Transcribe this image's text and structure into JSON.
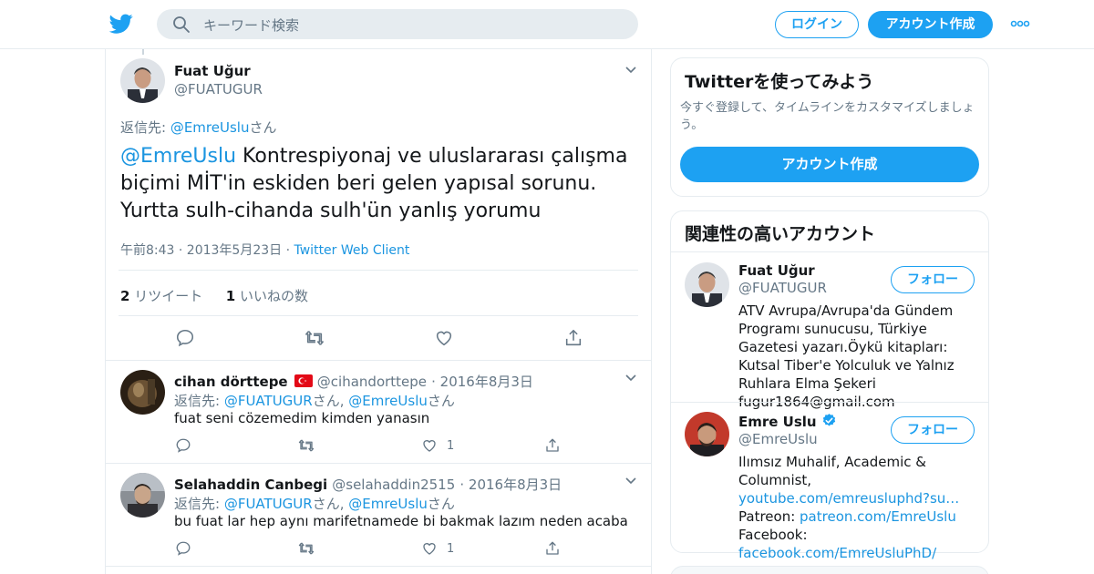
{
  "header": {
    "search_placeholder": "キーワード検索",
    "login_label": "ログイン",
    "signup_label": "アカウント作成"
  },
  "main_tweet": {
    "name": "Fuat Uğur",
    "handle": "@FUATUGUR",
    "reply_prefix": "返信先: ",
    "reply_mention": "@EmreUslu",
    "reply_suffix": "さん",
    "text_mention": "@EmreUslu",
    "text": " Kontrespiyonaj ve uluslararası çalışma biçimi MİT'in eskiden beri gelen yapısal sorunu. Yurtta sulh-cihanda sulh'ün yanlış yorumu",
    "timestamp": "午前8:43 · 2013年5月23日 · ",
    "source": "Twitter Web Client",
    "retweets_count": "2",
    "retweets_label": " リツイート",
    "likes_count": "1",
    "likes_label": " いいねの数"
  },
  "replies": [
    {
      "name": "cihan dörttepe",
      "flag": "🇹🇷",
      "handle": "@cihandorttepe",
      "date": "· 2016年8月3日",
      "reply_prefix": "返信先: ",
      "mention1": "@FUATUGUR",
      "sep": "さん, ",
      "mention2": "@EmreUslu",
      "suffix": "さん",
      "text": "fuat seni cözemedim kimden yanasın",
      "likes": "1"
    },
    {
      "name": "Selahaddin Canbegi",
      "handle": "@selahaddin2515",
      "date": "· 2016年8月3日",
      "reply_prefix": "返信先: ",
      "mention1": "@FUATUGUR",
      "sep": "さん, ",
      "mention2": "@EmreUslu",
      "suffix": "さん",
      "text": "bu fuat lar hep aynı marifetnamede bi bakmak lazım neden acaba",
      "likes": "1"
    }
  ],
  "sidebar": {
    "promo": {
      "title": "Twitterを使ってみよう",
      "subtitle": "今すぐ登録して、タイムラインをカスタマイズしましょう。",
      "button": "アカウント作成"
    },
    "related": {
      "title": "関連性の高いアカウント",
      "follow_label": "フォロー",
      "accounts": [
        {
          "name": "Fuat Uğur",
          "handle": "@FUATUGUR",
          "bio": "ATV Avrupa/Avrupa'da Gündem Programı sunucusu, Türkiye Gazetesi yazarı.Öykü kitapları: Kutsal Tiber'e Yolculuk ve Yalnız Ruhlara Elma Şekeri fugur1864@gmail.com"
        },
        {
          "name": "Emre Uslu",
          "handle": "@EmreUslu",
          "bio_line1": "Ilımsız Muhalif, Academic & Columnist,",
          "bio_link1": "youtube.com/emreusluphd?su…",
          "bio_label2": "Patreon: ",
          "bio_link2": "patreon.com/EmreUslu",
          "bio_label3": "Facebook:",
          "bio_link3": "facebook.com/EmreUsluPhD/"
        }
      ]
    }
  },
  "colors": {
    "accent": "#1da1f2",
    "link": "#1b95e0",
    "muted": "#657786",
    "border": "#e6ecf0",
    "like_red": "#e0245e"
  },
  "icons": [
    "twitter-bird-icon",
    "search-icon",
    "more-icon",
    "chevron-down-icon",
    "reply-icon",
    "retweet-icon",
    "like-icon",
    "share-icon",
    "verified-icon",
    "flag-tr-icon"
  ]
}
